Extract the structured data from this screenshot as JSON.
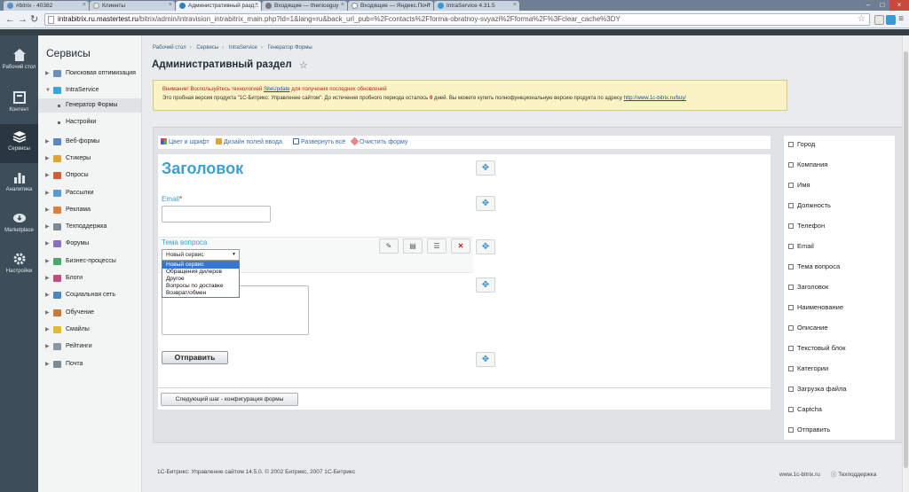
{
  "browser": {
    "tabs": [
      {
        "title": "#bitrix - 40382"
      },
      {
        "title": "Клиенты"
      },
      {
        "title": "Административный разд...",
        "active": true
      },
      {
        "title": "Входящие — theniceguy"
      },
      {
        "title": "Входящие — Яндекс.Почт"
      },
      {
        "title": "IntraService 4.31.5"
      }
    ],
    "url_host": "intrabitrix.ru.mastertest.ru",
    "url_path": "/bitrix/admin/intravision_intrabitrix_main.php?id=1&lang=ru&back_url_pub=%2Fcontacts%2Fforma-obratnoy-svyazi%2Fforma%2F%3Fclear_cache%3DY"
  },
  "left_nav": [
    {
      "label": "Рабочий стол",
      "icon": "home-icon"
    },
    {
      "label": "Контент",
      "icon": "content-icon"
    },
    {
      "label": "Сервисы",
      "icon": "layers-icon",
      "active": true
    },
    {
      "label": "Аналитика",
      "icon": "analytics-icon"
    },
    {
      "label": "Marketplace",
      "icon": "cloud-download-icon"
    },
    {
      "label": "Настройки",
      "icon": "gear-icon"
    }
  ],
  "services": {
    "title": "Сервисы",
    "items": [
      {
        "label": "Поисковая оптимизация",
        "color": "#6a8fb8"
      },
      {
        "label": "IntraService",
        "color": "#36a7d7"
      },
      {
        "label": "Веб-формы",
        "color": "#5a86c4"
      },
      {
        "label": "Стикеры",
        "color": "#e0a33a"
      },
      {
        "label": "Опросы",
        "color": "#d25b3a"
      },
      {
        "label": "Рассылки",
        "color": "#5a9ad6"
      },
      {
        "label": "Реклама",
        "color": "#e07d3a"
      },
      {
        "label": "Техподдержка",
        "color": "#7a8a96"
      },
      {
        "label": "Форумы",
        "color": "#8a6fc0"
      },
      {
        "label": "Бизнес-процессы",
        "color": "#4aa86a"
      },
      {
        "label": "Блоги",
        "color": "#c24a7d"
      },
      {
        "label": "Социальная сеть",
        "color": "#4a86c4"
      },
      {
        "label": "Обучение",
        "color": "#c77a3a"
      },
      {
        "label": "Смайлы",
        "color": "#e5b83a"
      },
      {
        "label": "Рейтинги",
        "color": "#8a96a2"
      },
      {
        "label": "Почта",
        "color": "#7a8a96"
      }
    ],
    "sub_items": [
      {
        "label": "Генератор Формы",
        "active": true
      },
      {
        "label": "Настройки"
      }
    ]
  },
  "breadcrumb": [
    "Рабочий стол",
    "Сервисы",
    "IntraService",
    "Генератор Формы"
  ],
  "page_title": "Административный раздел",
  "alert": {
    "line1_prefix": "Внимание! Воспользуйтесь технологией ",
    "line1_link": "SiteUpdate",
    "line1_suffix": " для получения последних обновлений",
    "line2_prefix": "Это пробная версия продукта \"1С-Битрикс: Управление сайтом\". До истечения пробного периода осталось ",
    "days": "0",
    "line2_middle": " дней. Вы можете купить полнофункциональную версию продукта по адресу ",
    "line2_link": "http://www.1c-bitrix.ru/buy/"
  },
  "toolbar": {
    "color_font": "Цвет и шрифт",
    "field_design": "Дизайн полей ввода",
    "expand_all": "Развернуть всё",
    "clear_form": "Очистить форму"
  },
  "form": {
    "title": "Заголовок",
    "email_label": "Email",
    "required_mark": "*",
    "topic_label": "Тема вопроса",
    "select_value": "Новый сервис",
    "options": [
      "Новый сервис",
      "Обращения дилеров",
      "Другое",
      "Вопросы по доставке",
      "Возврат/обмен"
    ],
    "submit_label": "Отправить",
    "next_step_label": "Следующий шаг - конфигурация формы"
  },
  "field_list": [
    "Город",
    "Компания",
    "Имя",
    "Должность",
    "Телефон",
    "Email",
    "Тема вопроса",
    "Заголовок",
    "Наименование",
    "Описание",
    "Текстовый блок",
    "Категории",
    "Загрузка файла",
    "Captcha",
    "Отправить"
  ],
  "footer": {
    "copyright": "1С-Битрикс: Управление сайтом 14.5.0. © 2002 Битрикс, 2007 1С-Битрикс",
    "site": "www.1c-bitrix.ru",
    "help": "Техподдержка"
  }
}
